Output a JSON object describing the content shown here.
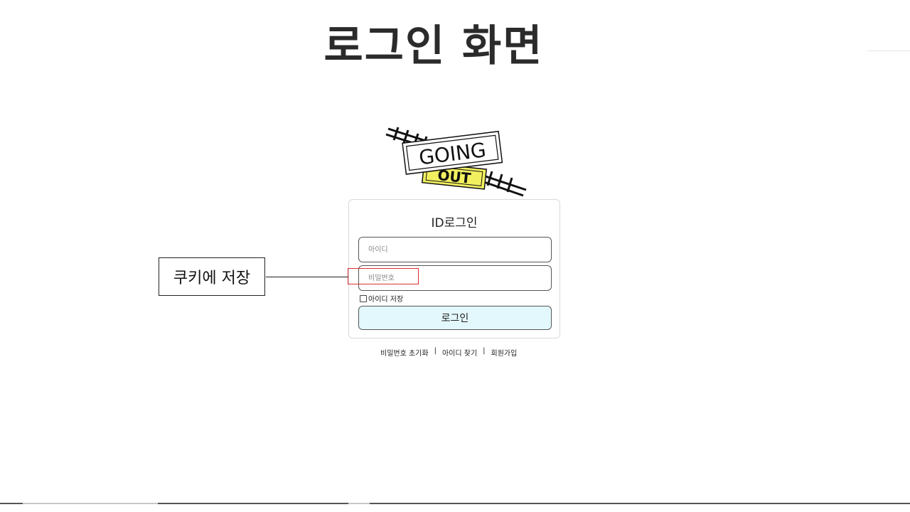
{
  "header": {
    "title": "로그인 화면"
  },
  "logo": {
    "line1": "GOING",
    "line2": "OUT",
    "accent": "#f3f060"
  },
  "login_card": {
    "title": "ID로그인",
    "id_placeholder": "아이디",
    "password_placeholder": "비밀번호",
    "remember_label": "아이디 저장",
    "login_button": "로그인",
    "button_color": "#e3f8fc"
  },
  "links": {
    "reset_password": "비밀번호 초기화",
    "separator": "|",
    "find_id": "아이디 찾기",
    "signup": "회원가입"
  },
  "annotation": {
    "label": "쿠키에 저장",
    "highlight_color": "#d93030"
  }
}
